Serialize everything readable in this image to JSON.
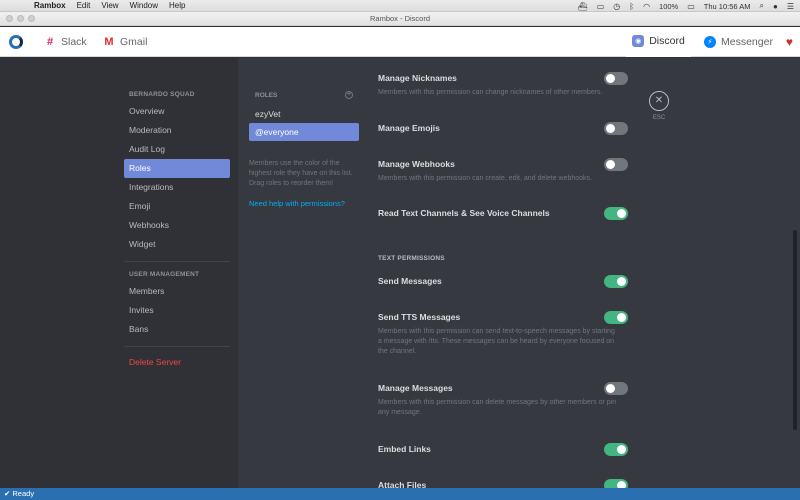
{
  "menubar": {
    "app": "Rambox",
    "items": [
      "Edit",
      "View",
      "Window",
      "Help"
    ],
    "battery": "100%",
    "clock": "Thu 10:56 AM"
  },
  "window": {
    "title": "Rambox - Discord"
  },
  "tabs": {
    "slack": "Slack",
    "gmail": "Gmail",
    "discord": "Discord",
    "messenger": "Messenger"
  },
  "sidebar": {
    "server_header": "BERNARDO SQUAD",
    "server_items": [
      "Overview",
      "Moderation",
      "Audit Log",
      "Roles",
      "Integrations",
      "Emoji",
      "Webhooks",
      "Widget"
    ],
    "user_header": "USER MANAGEMENT",
    "user_items": [
      "Members",
      "Invites",
      "Bans"
    ],
    "danger": "Delete Server"
  },
  "roles": {
    "header": "ROLES",
    "items": [
      "ezyVet",
      "@everyone"
    ],
    "note": "Members use the color of the highest role they have on this list. Drag roles to reorder them!",
    "help_link": "Need help with permissions?"
  },
  "permissions": {
    "manage_nicknames": {
      "title": "Manage Nicknames",
      "desc": "Members with this permission can change nicknames of other members.",
      "on": false
    },
    "manage_emojis": {
      "title": "Manage Emojis",
      "on": false
    },
    "manage_webhooks": {
      "title": "Manage Webhooks",
      "desc": "Members with this permission can create, edit, and delete webhooks.",
      "on": false
    },
    "read_channels": {
      "title": "Read Text Channels & See Voice Channels",
      "on": true
    },
    "text_section": "TEXT PERMISSIONS",
    "send_messages": {
      "title": "Send Messages",
      "on": true
    },
    "send_tts": {
      "title": "Send TTS Messages",
      "desc": "Members with this permission can send text-to-speech messages by starting a message with /tts. These messages can be heard by everyone focused on the channel.",
      "on": true
    },
    "manage_messages": {
      "title": "Manage Messages",
      "desc": "Members with this permission can delete messages by other members or pin any message.",
      "on": false
    },
    "embed_links": {
      "title": "Embed Links",
      "on": true
    },
    "attach_files": {
      "title": "Attach Files",
      "on": true
    }
  },
  "close": {
    "label": "ESC"
  },
  "status": {
    "text": "Ready"
  }
}
